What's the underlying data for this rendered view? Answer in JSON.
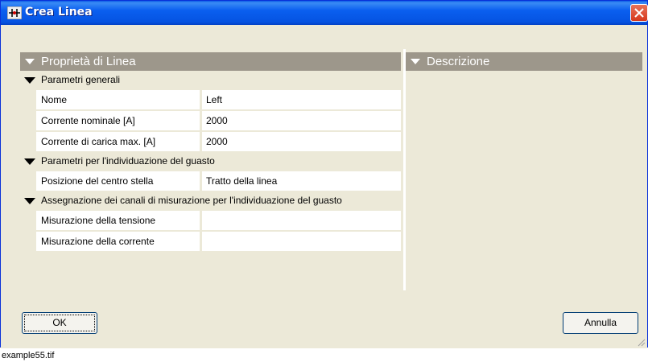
{
  "window": {
    "title": "Crea Linea",
    "icon": "line-network-icon"
  },
  "left_panel": {
    "header": "Proprietà di Linea",
    "sections": [
      {
        "title": "Parametri generali",
        "rows": [
          {
            "label": "Nome",
            "value": "Left"
          },
          {
            "label": "Corrente nominale [A]",
            "value": "2000"
          },
          {
            "label": "Corrente di carica max. [A]",
            "value": "2000"
          }
        ]
      },
      {
        "title": "Parametri per l'individuazione del guasto",
        "rows": [
          {
            "label": "Posizione del centro stella",
            "value": "Tratto della linea"
          }
        ]
      },
      {
        "title": "Assegnazione dei canali di misurazione per l'individuazione del guasto",
        "rows": [
          {
            "label": "Misurazione della tensione",
            "value": ""
          },
          {
            "label": "Misurazione della corrente",
            "value": ""
          }
        ]
      }
    ]
  },
  "right_panel": {
    "header": "Descrizione"
  },
  "buttons": {
    "ok": "OK",
    "cancel": "Annulla"
  },
  "caption": "example55.tif",
  "colors": {
    "titlebar": "#0553e1",
    "panel_header": "#9d978b",
    "dialog_bg": "#ece9d8",
    "close_button": "#d6381c"
  }
}
